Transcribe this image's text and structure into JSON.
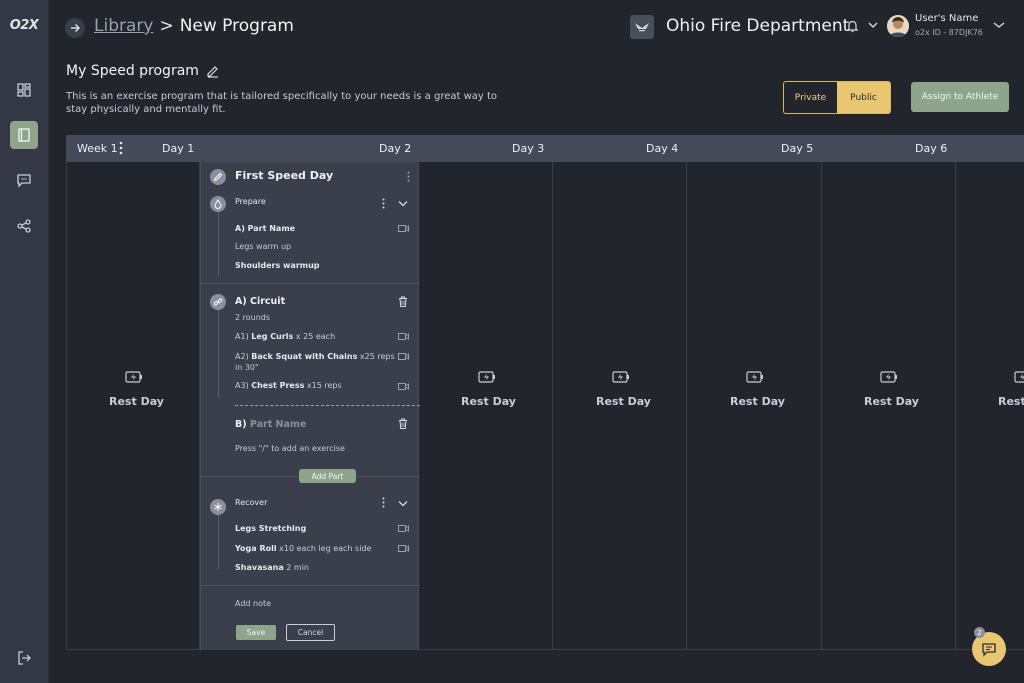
{
  "app": {
    "logo_text": "O2X"
  },
  "header": {
    "breadcrumb_library": "Library",
    "breadcrumb_sep": ">",
    "breadcrumb_current": "New Program",
    "org_name": "Ohio Fire Department",
    "user_name": "User's Name",
    "user_id": "o2x ID - 87DJK76"
  },
  "program": {
    "title": "My Speed program",
    "description": "This is an exercise program that is tailored specifically to your needs is a great way to stay physically and mentally fit.",
    "visibility_private": "Private",
    "visibility_public": "Public",
    "visibility_selected": "Public",
    "assign_label": "Assign to Athlete"
  },
  "week": {
    "label": "Week 1",
    "days": [
      "Day 1",
      "Day 2",
      "Day 3",
      "Day 4",
      "Day 5",
      "Day 6"
    ],
    "rest_label": "Rest Day"
  },
  "card": {
    "title": "First Speed Day",
    "prepare": {
      "label": "Prepare",
      "part": "A) Part Name",
      "items": [
        "Legs warm up",
        "Shoulders warmup"
      ]
    },
    "circuit": {
      "label": "A) Circuit",
      "rounds": "2 rounds",
      "items": [
        {
          "prefix": "A1)",
          "name": "Leg Curls",
          "detail": "x 25 each"
        },
        {
          "prefix": "A2)",
          "name": "Back Squat with Chains",
          "detail": "x25 reps",
          "detail2": "in 30\""
        },
        {
          "prefix": "A3)",
          "name": "Chest Press",
          "detail": "x15 reps"
        }
      ]
    },
    "part_b": {
      "prefix": "B)",
      "placeholder": "Part Name",
      "hint": "Press \"/\" to add an exercise",
      "add_part_label": "Add Part"
    },
    "recover": {
      "label": "Recover",
      "items": [
        {
          "name": "Legs Stretching",
          "detail": ""
        },
        {
          "name": "Yoga Roll",
          "detail": "x10 each leg each side"
        },
        {
          "name": "Shavasana",
          "detail": "2 min"
        }
      ]
    },
    "add_note": "Add note",
    "save": "Save",
    "cancel": "Cancel"
  },
  "chat": {
    "badge": "2"
  },
  "colors": {
    "background": "#23252d",
    "sidebar": "#343844",
    "accent_green": "#8fa48d",
    "accent_gold": "#e9c672",
    "card": "#3b3f4b",
    "header_bar": "#454a58"
  },
  "icons": [
    "logo",
    "dashboard-icon",
    "notebook-icon",
    "chat-icon",
    "share-icon",
    "logout-icon",
    "arrow-right-icon",
    "edit-icon",
    "bell-icon",
    "chevron-down-icon",
    "kebab-icon",
    "camera-icon",
    "trash-icon",
    "link-icon",
    "drop-icon",
    "snowflake-icon",
    "battery-charging-icon",
    "chat-bubble-icon"
  ]
}
